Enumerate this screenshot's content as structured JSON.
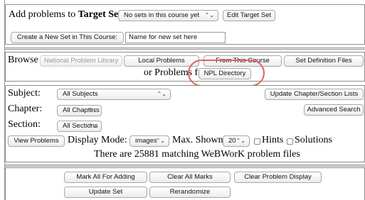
{
  "add_row": {
    "label_prefix": "Add problems to",
    "label_bold": "Target Set:",
    "target_set_selected": "No sets in this course yet",
    "edit_target_set_button": "Edit Target Set"
  },
  "create_row": {
    "create_button": "Create a New Set in This Course:",
    "new_set_name_value": "Name for new set here"
  },
  "browse": {
    "label": "Browse",
    "npl_button": "National Problem Library",
    "local_problems_button": "Local Problems",
    "from_course_button": "From This Course",
    "set_definition_button": "Set Definition Files",
    "problems_from_text": "or Problems from",
    "npl_directory_button": "NPL Directory"
  },
  "filters": {
    "subject_label": "Subject:",
    "subject_selected": "All Subjects",
    "update_lists_button": "Update Chapter/Section Lists",
    "chapter_label": "Chapter:",
    "chapter_selected": "All Chapters",
    "advanced_search_button": "Advanced Search",
    "section_label": "Section:",
    "section_selected": "All Sections",
    "view_problems_button": "View Problems",
    "display_mode_label": "Display Mode:",
    "display_mode_selected": "images",
    "max_shown_label": "Max. Shown:",
    "max_shown_selected": "20",
    "hints_label": "Hints",
    "solutions_label": "Solutions",
    "match_count_text": "There are 25881 matching WeBWorK problem files"
  },
  "actions": {
    "mark_all_button": "Mark All For Adding",
    "clear_marks_button": "Clear All Marks",
    "clear_display_button": "Clear Problem Display",
    "update_set_button": "Update Set",
    "randomize_button": "Rerandomize"
  },
  "icons": {
    "select_arrow": "⌃⌄"
  },
  "colors": {
    "highlight": "#e0625a"
  }
}
